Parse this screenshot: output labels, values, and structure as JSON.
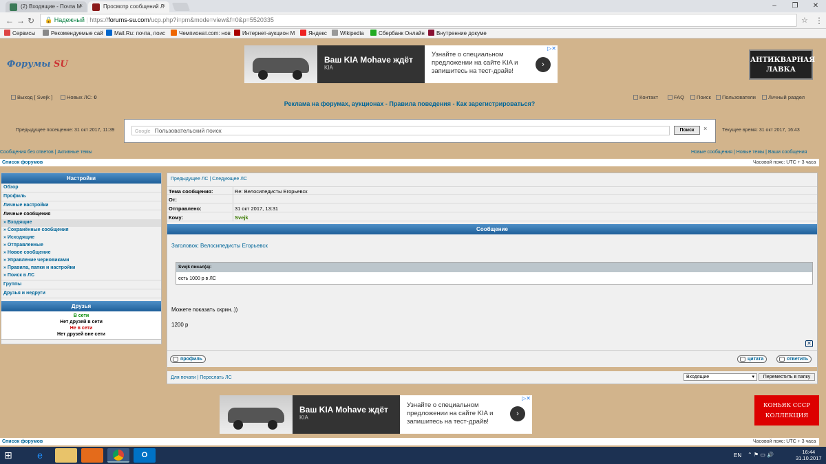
{
  "browser": {
    "tabs": [
      {
        "title": "(2) Входящие - Почта М",
        "active": false
      },
      {
        "title": "Просмотр сообщений Л",
        "active": true
      }
    ],
    "window_title": "",
    "secure_label": "Надежный",
    "url_scheme": "https://",
    "url_host": "forums-su.com",
    "url_rest": "/ucp.php?i=pm&mode=view&f=0&p=5520335",
    "bookmarks": [
      "Сервисы",
      "Рекомендуемые сай",
      "Mail.Ru: почта, поис",
      "Чемпионат.com: нов",
      "Интернет-аукцион М",
      "Яндекс",
      "Wikipedia",
      "Сбербанк Онлайн",
      "Внутренние докуме"
    ]
  },
  "header": {
    "logo_main": "Форумы",
    "logo_accent": "SU",
    "ad": {
      "headline": "Ваш KIA Mohave ждёт",
      "brand": "KIA",
      "copy": "Узнайте о специальном предложении на сайте KIA и запишитесь на тест-драйв!",
      "arrow": "›"
    },
    "side_banner": "АНТИКВАРНАЯ ЛАВКА"
  },
  "userbar": {
    "logout": "Выход [ Svejk ]",
    "new_pm_label": "Новых ЛС:",
    "new_pm_count": "0",
    "right_links": [
      "Контакт",
      "FAQ",
      "Поиск",
      "Пользователи",
      "Личный раздел"
    ]
  },
  "site_links": "Реклама на форумах, аукционах - Правила поведения - Как зарегистрироваться?",
  "search": {
    "google": "Google",
    "placeholder": "Пользовательский поиск",
    "button": "Поиск",
    "clear": "×"
  },
  "last_visit": "Предыдущее посещение: 31 окт 2017, 11:39",
  "current_time": "Текущее время: 31 окт 2017, 16:43",
  "nav_left": "Сообщения без ответов | Активные темы",
  "nav_right": "Новые сообщения | Новые темы | Ваши сообщения",
  "breadcrumb": "Список форумов",
  "timezone": "Часовой пояс: UTC + 3 часа",
  "sidebar": {
    "header": "Настройки",
    "items": [
      "Обзор",
      "Профиль",
      "Личные настройки"
    ],
    "pm_title": "Личные сообщения",
    "pm_items": [
      "» Входящие",
      "» Сохранённые сообщения",
      "» Исходящие",
      "» Отправленные",
      "» Новое сообщение",
      "» Управление черновиками",
      "» Правила, папки и настройки",
      "» Поиск в ЛС"
    ],
    "items2": [
      "Группы",
      "Друзья и недруги"
    ],
    "friends_header": "Друзья",
    "online": "В сети",
    "no_online": "Нет друзей в сети",
    "offline": "Не в сети",
    "no_offline": "Нет друзей вне сети"
  },
  "message": {
    "nav": "Предыдущее ЛС | Следующее ЛС",
    "subject_label": "Тема сообщения:",
    "subject": "Re: Велосипедисты Егорьевск",
    "from_label": "От:",
    "from": "",
    "sent_label": "Отправлено:",
    "sent": "31 окт 2017, 13:31",
    "to_label": "Кому:",
    "to": "Svejk",
    "header": "Сообщение",
    "title": "Заголовок: Велосипедисты Егорьевск",
    "quote_author": "Svejk писал(а):",
    "quote_text": "есть 1000 р в ЛС",
    "body_line1": "Можете показать скрин..))",
    "body_line2": "1200 р",
    "profile_btn": "профиль",
    "quote_btn": "цитата",
    "reply_btn": "ответить",
    "footer_left": "Для печати | Переслать ЛС",
    "folder_select": "Входящие",
    "move_btn": "Переместить в папку"
  },
  "bottom": {
    "breadcrumb": "Список форумов",
    "timezone": "Часовой пояс: UTC + 3 часа",
    "konyak_line1": "КОНЬЯК СССР",
    "konyak_line2": "КОЛЛЕКЦИЯ"
  },
  "taskbar": {
    "lang": "EN",
    "time": "16:44",
    "date": "31.10.2017"
  }
}
